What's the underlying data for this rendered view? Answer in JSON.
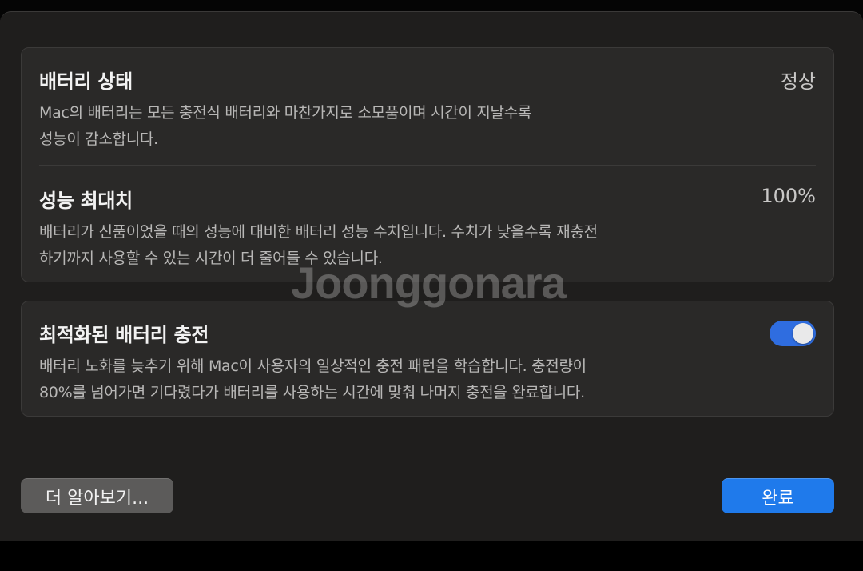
{
  "battery_status": {
    "title": "배터리 상태",
    "value": "정상",
    "desc_lines": [
      "Mac의 배터리는 모든 충전식 배터리와 마찬가지로 소모품이며 시간이 지날수록",
      "성능이 감소합니다."
    ]
  },
  "max_capacity": {
    "title": "성능 최대치",
    "value": "100%",
    "desc_lines": [
      "배터리가 신품이었을 때의 성능에 대비한 배터리 성능 수치입니다. 수치가 낮을수록 재충전",
      "하기까지 사용할 수 있는 시간이 더 줄어들 수 있습니다."
    ]
  },
  "optimized_charging": {
    "title": "최적화된 배터리 충전",
    "enabled": true,
    "desc_lines": [
      "배터리 노화를 늦추기 위해 Mac이 사용자의 일상적인 충전 패턴을 학습합니다. 충전량이",
      "80%를 넘어가면 기다렸다가 배터리를 사용하는 시간에 맞춰 나머지 충전을 완료합니다."
    ]
  },
  "footer": {
    "learn_more_label": "더 알아보기...",
    "done_label": "완료"
  },
  "watermark": "Joonggonara",
  "colors": {
    "accent": "#1f7aeb",
    "toggle_on": "#2f6de0",
    "panel": "#2a2928",
    "sheet": "#1f1e1d"
  }
}
